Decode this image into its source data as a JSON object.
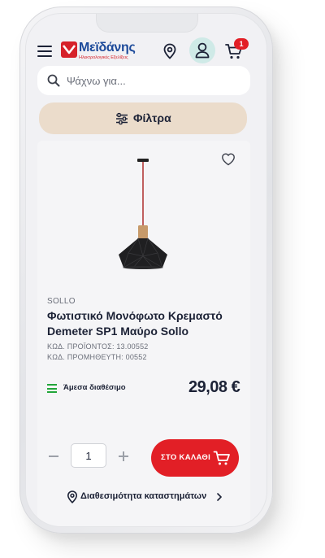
{
  "brand": {
    "name": "Μεϊδάνης",
    "tagline": "Ηλεκτρολογικές Εξελίξεις"
  },
  "header": {
    "cart_count": "1"
  },
  "search": {
    "placeholder": "Ψάχνω για..."
  },
  "filters": {
    "label": "Φίλτρα"
  },
  "product": {
    "brand": "SOLLO",
    "title": "Φωτιστικό Μονόφωτο Κρεμαστό Demeter SP1 Μαύρο Sollo",
    "product_code": "ΚΩΔ. ΠΡΟΪΟΝΤΟΣ: 13.00552",
    "supplier_code": "ΚΩΔ. ΠΡΟΜΗΘΕΥΤΗ: 00552",
    "availability": "Άμεσα διαθέσιμο",
    "price": "29,08 €",
    "quantity": "1",
    "add_to_cart_label": "ΣΤΟ ΚΑΛΑΘΙ",
    "store_availability_label": "Διαθεσιμότητα καταστημάτων"
  },
  "colors": {
    "accent_red": "#e21f26",
    "brand_blue": "#1c4a9a",
    "filters_bg": "#ebdccb",
    "user_btn_bg": "#cfeae7",
    "availability_green": "#22a53a",
    "text_dark": "#1c2236"
  },
  "icons": [
    "menu-icon",
    "logo-mark-icon",
    "location-pin-icon",
    "user-icon",
    "cart-icon",
    "search-icon",
    "sliders-icon",
    "heart-icon",
    "availability-icon",
    "minus-icon",
    "plus-icon",
    "chevron-right-icon"
  ]
}
